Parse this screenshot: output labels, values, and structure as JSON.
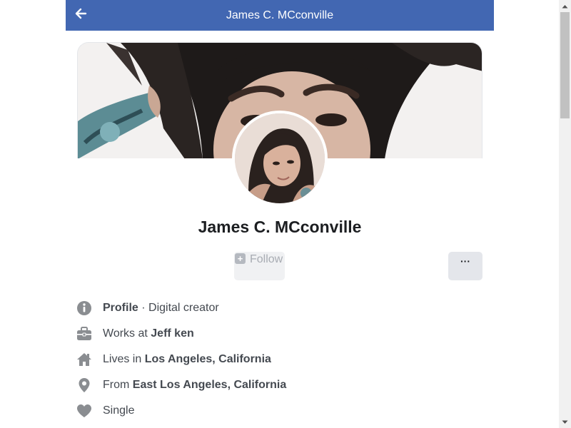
{
  "header": {
    "title": "James C. MCconville",
    "back_icon": "arrow-left-icon",
    "background_color": "#4267b2"
  },
  "profile": {
    "name": "James C. MCconville",
    "cover_image": "cover-photo",
    "avatar_image": "profile-photo"
  },
  "actions": {
    "follow_label": "Follow",
    "follow_icon": "plus-square-icon",
    "more_label": "···"
  },
  "info": {
    "profile": {
      "icon": "info-circle-icon",
      "label": "Profile",
      "separator": " · ",
      "value": "Digital creator"
    },
    "work": {
      "icon": "briefcase-icon",
      "prefix": "Works at ",
      "value": "Jeff ken"
    },
    "lives": {
      "icon": "home-icon",
      "prefix": "Lives in ",
      "value": "Los Angeles, California"
    },
    "from": {
      "icon": "location-pin-icon",
      "prefix": "From ",
      "value": "East Los Angeles, California"
    },
    "relationship": {
      "icon": "heart-icon",
      "value": "Single"
    }
  },
  "colors": {
    "icon_gray": "#8a8d91",
    "text": "#444950",
    "name": "#1c1e21"
  }
}
